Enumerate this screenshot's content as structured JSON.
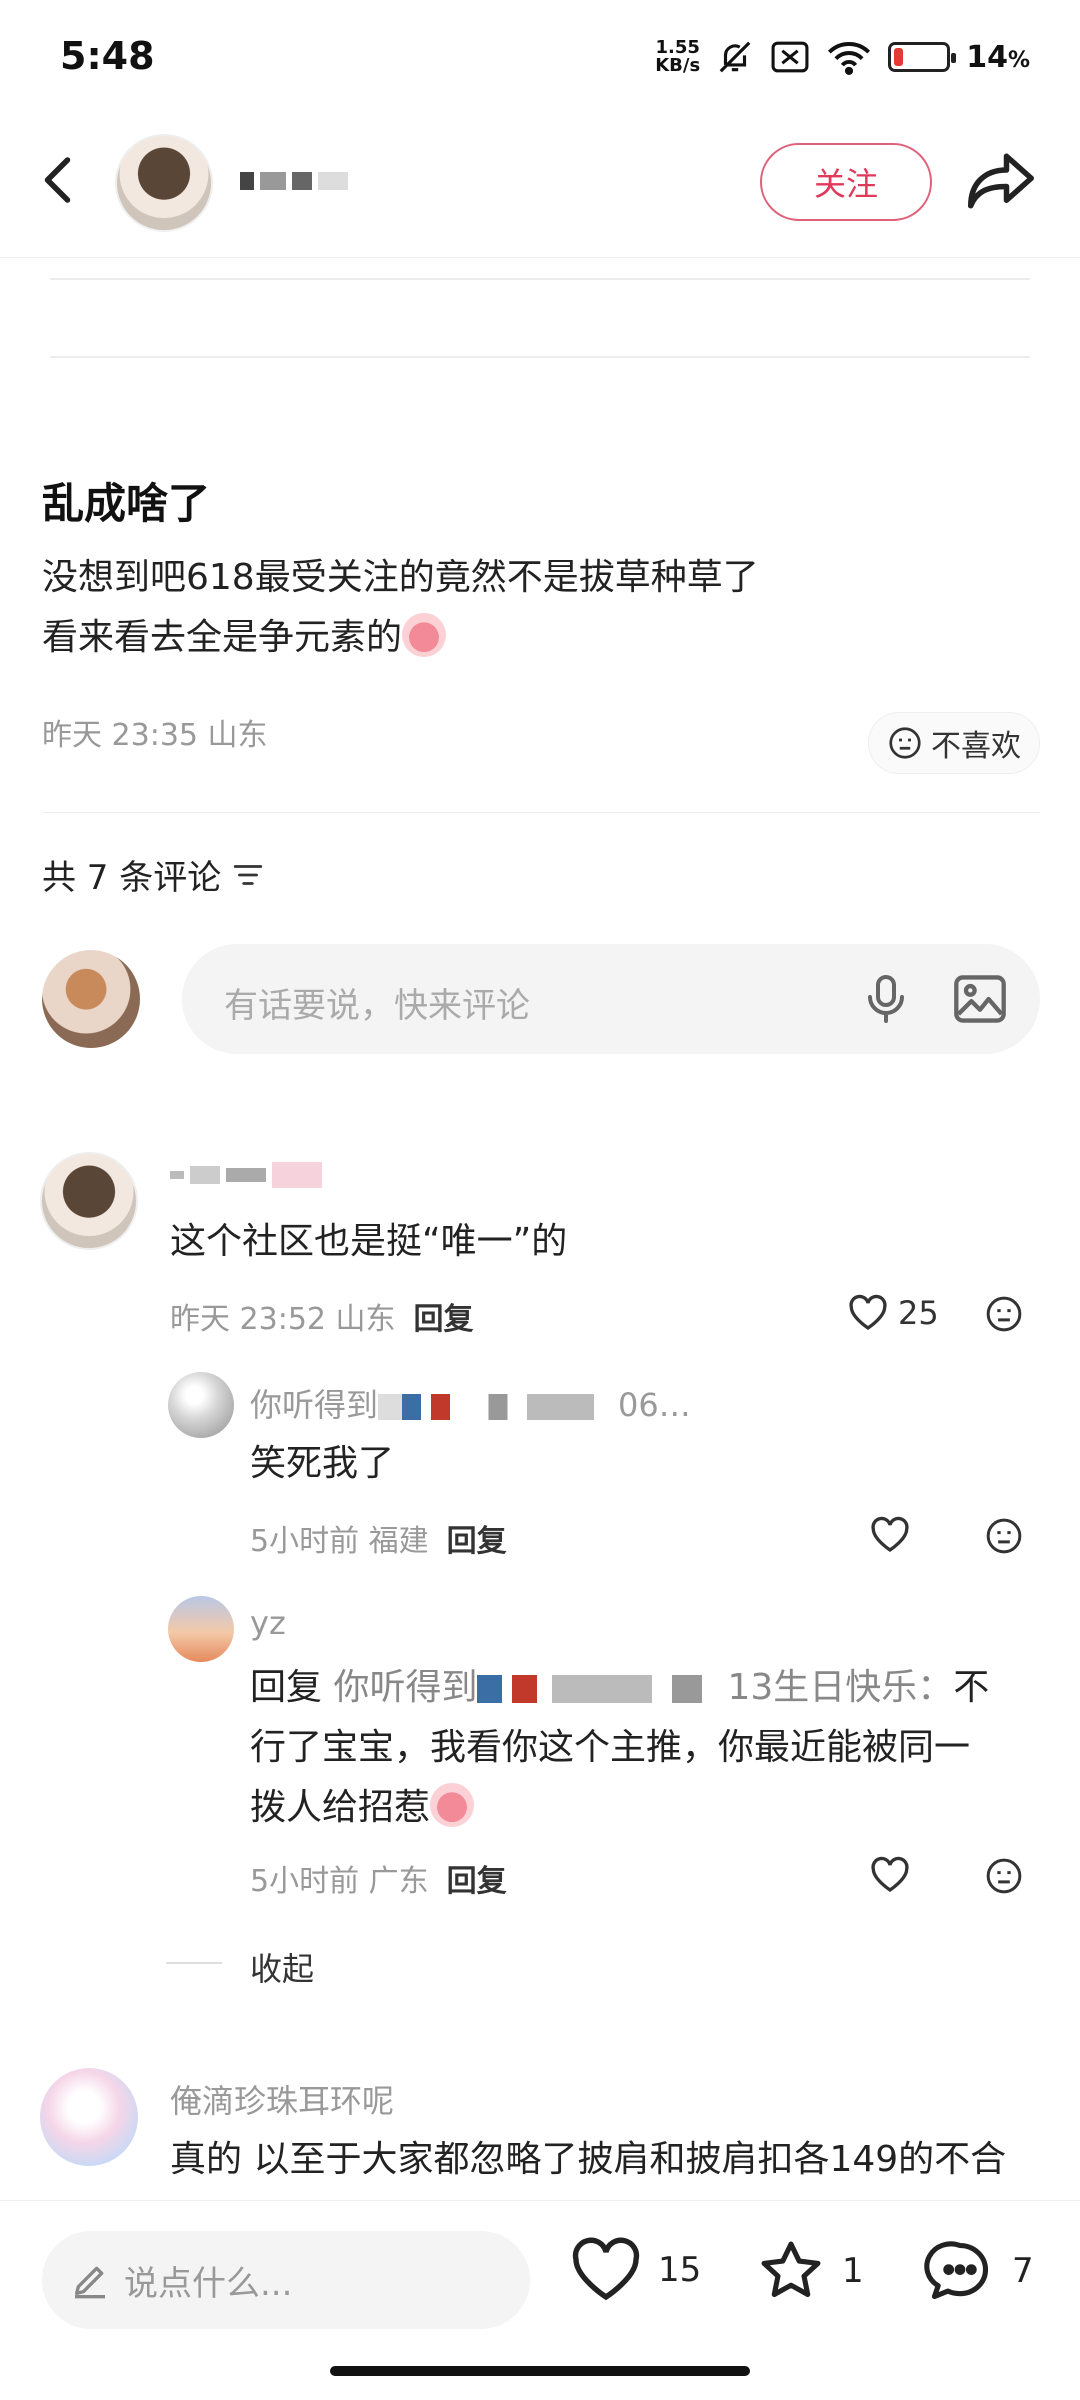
{
  "status_bar": {
    "time": "5:48",
    "net_speed_value": "1.55",
    "net_speed_unit": "KB/s",
    "battery_percent_value": 14,
    "battery_text": "14",
    "battery_unit": "%"
  },
  "header": {
    "follow_label": "关注"
  },
  "post": {
    "title": "乱成啥了",
    "body_line1": "没想到吧618最受关注的竟然不是拔草种草了",
    "body_line2": "看来看去全是争元素的",
    "meta": "昨天 23:35 山东",
    "dislike_label": "不喜欢"
  },
  "comments_header": {
    "count_label": "共 7 条评论"
  },
  "comment_input": {
    "placeholder": "有话要说，快来评论"
  },
  "comments": [
    {
      "text": "这个社区也是挺“唯一”的",
      "time": "昨天 23:52 山东",
      "reply_label": "回复",
      "likes": "25"
    },
    {
      "name": "你听得到",
      "name_tail": "06…",
      "text": "笑死我了",
      "time": "5小时前 福建",
      "reply_label": "回复"
    },
    {
      "name": "yz",
      "reply_prefix": "回复",
      "mention": "你听得到",
      "mention_tail": "13生日快乐：",
      "text_line1_end": "不",
      "text_line2": "行了宝宝，我看你这个主推，你最近能被同一",
      "text_line3": "拨人给招惹",
      "time": "5小时前 广东",
      "reply_label": "回复"
    },
    {
      "name": "俺滴珍珠耳环呢",
      "text": "真的 以至于大家都忽略了披肩和披肩扣各149的不合"
    }
  ],
  "collapse_label": "收起",
  "bottom_bar": {
    "say_placeholder": "说点什么...",
    "likes": "15",
    "stars": "1",
    "comments": "7"
  }
}
